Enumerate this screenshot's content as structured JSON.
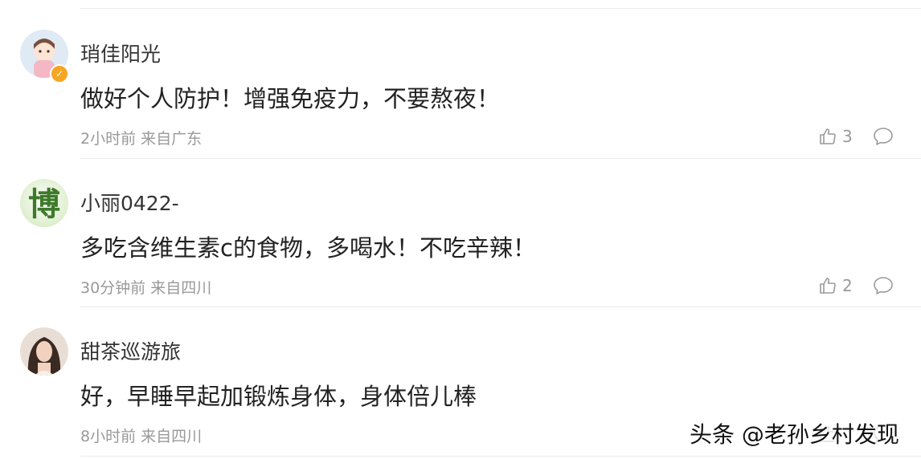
{
  "comments": [
    {
      "username": "琑佳阳光",
      "content": "做好个人防护！增强免疫力，不要熬夜！",
      "time": "2小时前",
      "location": "来自广东",
      "meta": "2小时前 来自广东",
      "likes": "3",
      "avatar_icon": "cartoon-girl-avatar-icon",
      "verified": true
    },
    {
      "username": "小丽0422-",
      "content": "多吃含维生素c的食物，多喝水！不吃辛辣！",
      "time": "30分钟前",
      "location": "来自四川",
      "meta": "30分钟前 来自四川",
      "likes": "2",
      "avatar_icon": "bo-character-avatar-icon",
      "avatar_char": "博"
    },
    {
      "username": "甜茶巡游旅",
      "content": "好，早睡早起加锻炼身体，身体倍儿棒",
      "time": "8小时前",
      "location": "来自四川",
      "meta": "8小时前 来自四川",
      "likes": "",
      "avatar_icon": "photo-woman-avatar-icon"
    }
  ],
  "watermark": "头条 @老孙乡村发现",
  "colors": {
    "meta_text": "#999999",
    "verified_badge": "#f5a623",
    "avatar_bo_green": "#3d7a2a"
  }
}
